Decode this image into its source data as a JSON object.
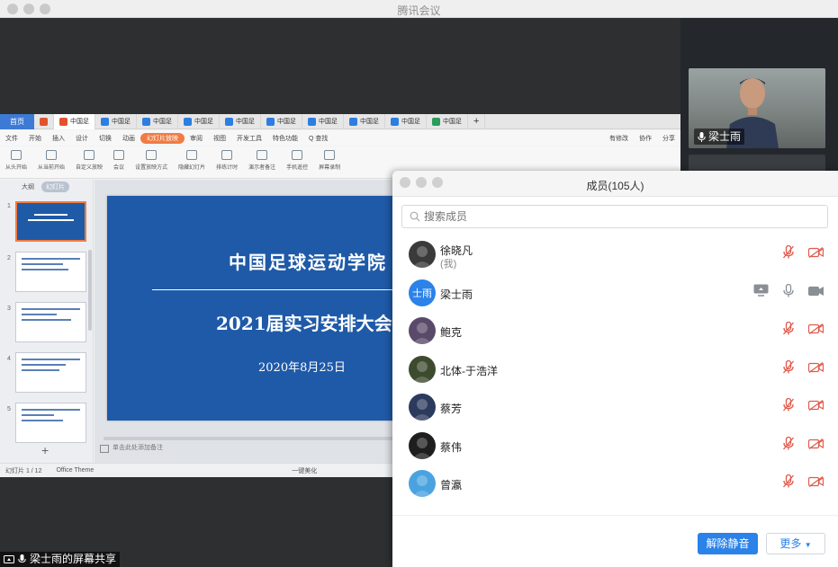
{
  "app": {
    "title": "腾讯会议"
  },
  "video": {
    "name": "梁士雨"
  },
  "wps": {
    "home_tab": "首页",
    "tabs": [
      "中国足",
      "中国足",
      "中国足",
      "中国足",
      "中国足",
      "中国足",
      "中国足",
      "中国足",
      "中国足",
      "中国足"
    ],
    "tab_colors": [
      "#e2532c",
      "#2d7ee0",
      "#2d7ee0",
      "#2d7ee0",
      "#2d7ee0",
      "#2d7ee0",
      "#2d7ee0",
      "#2d7ee0",
      "#2d7ee0",
      "#2a9d5c"
    ],
    "menu": [
      "文件",
      "开始",
      "插入",
      "设计",
      "切换",
      "动画",
      "幻灯片放映",
      "审阅",
      "视图",
      "开发工具",
      "特色功能",
      "Q 查找"
    ],
    "menu_right": [
      "有修改",
      "协作",
      "分享"
    ],
    "ribbon": [
      "从头开始",
      "从当前开始",
      "自定义放映",
      "会议",
      "设置放映方式",
      "隐藏幻灯片",
      "排练计时",
      "演示者备注",
      "手机遥控",
      "屏幕录制"
    ],
    "left_tabs": [
      "大纲",
      "幻灯片"
    ],
    "slide": {
      "title1": "中国足球运动学院",
      "title2": "2021届实习安排大会",
      "date": "2020年8月25日"
    },
    "notes_placeholder": "单击此处添加备注",
    "status": [
      "幻灯片 1 / 12",
      "Office Theme",
      "一键美化"
    ]
  },
  "members": {
    "title": "成员(105人)",
    "search_placeholder": "搜索成员",
    "list": [
      {
        "name": "徐晓凡",
        "sub": "(我)",
        "avatar": "photo",
        "avatar_color": "#3a3a3a",
        "muted": true
      },
      {
        "name": "梁士雨",
        "sub": "",
        "avatar": "text",
        "avatar_text": "士雨",
        "avatar_color": "#2b82e8",
        "muted": false,
        "sharing": true
      },
      {
        "name": "鲍克",
        "sub": "",
        "avatar": "photo",
        "avatar_color": "#5a4a6a",
        "muted": true
      },
      {
        "name": "北体-于浩洋",
        "sub": "",
        "avatar": "photo",
        "avatar_color": "#3d4a2e",
        "muted": true
      },
      {
        "name": "蔡芳",
        "sub": "",
        "avatar": "photo",
        "avatar_color": "#2c3a5e",
        "muted": true
      },
      {
        "name": "蔡伟",
        "sub": "",
        "avatar": "photo",
        "avatar_color": "#1e1e1e",
        "muted": true
      },
      {
        "name": "曾瀛",
        "sub": "",
        "avatar": "photo",
        "avatar_color": "#4aa3e0",
        "muted": true
      }
    ],
    "unmute_all": "解除静音",
    "more": "更多"
  },
  "share_label": "梁士雨的屏幕共享",
  "colors": {
    "accent": "#2b82e8",
    "muted_red": "#e05a4b",
    "slide_blue": "#1f5aa8"
  }
}
